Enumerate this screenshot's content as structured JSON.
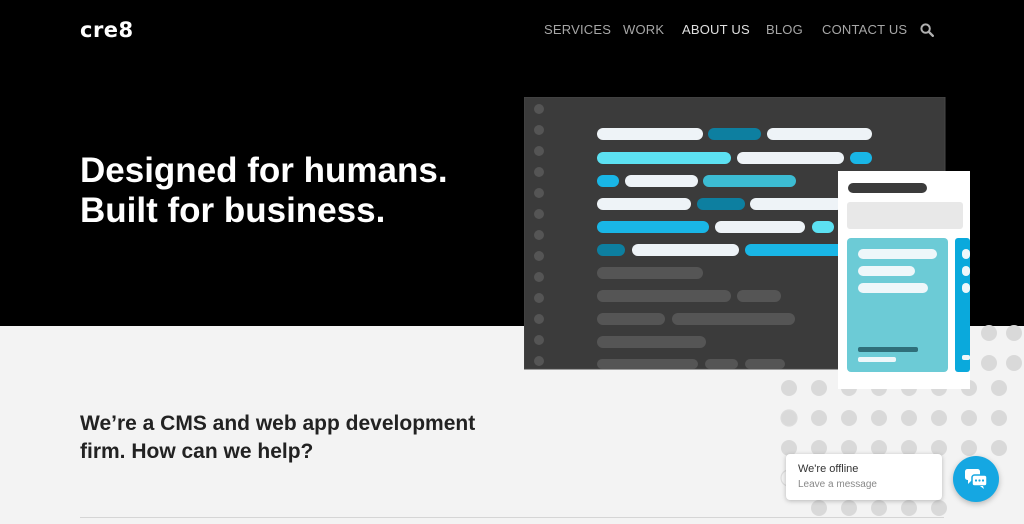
{
  "brand": {
    "logo": "cre8"
  },
  "nav": {
    "items": [
      {
        "label": "SERVICES"
      },
      {
        "label": "WORK"
      },
      {
        "label": "ABOUT US"
      },
      {
        "label": "BLOG"
      },
      {
        "label": "CONTACT US"
      }
    ],
    "active": "ABOUT US",
    "search_icon": "search-icon"
  },
  "hero": {
    "line1": "Designed for humans.",
    "line2": "Built for business."
  },
  "intro": {
    "line1": "We’re a CMS and web app development",
    "line2": "firm. How can we help?"
  },
  "chat": {
    "title": "We're offline",
    "subtitle": "Leave a message",
    "icon": "chat-bubbles-icon"
  },
  "colors": {
    "hero_bg": "#000000",
    "accent_cyan": "#5ce1f2",
    "accent_blue": "#0aa9dc",
    "teal_card": "#6ccbd6",
    "chat_button": "#15a7e2"
  }
}
